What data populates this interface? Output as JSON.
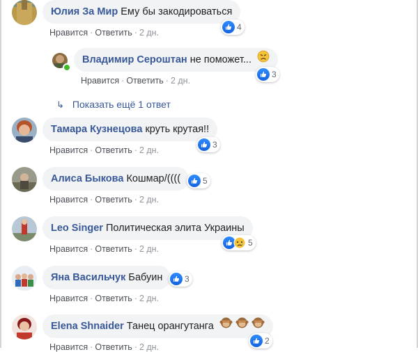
{
  "actions": {
    "like": "Нравится",
    "reply": "Ответить",
    "sep": "·"
  },
  "comments": [
    {
      "author": "Юлия За Мир",
      "text": "Ему бы закодироваться",
      "reactions": [
        "like"
      ],
      "count": "4",
      "time": "2 дн."
    },
    {
      "author": "Владимир Сероштан",
      "text": "не поможет...",
      "reactions": [
        "like"
      ],
      "count": "3",
      "time": "2 дн.",
      "emoji": "sad-face"
    },
    {
      "author": "Тамара Кузнецова",
      "text": "круть крутая!!",
      "reactions": [
        "like"
      ],
      "count": "3",
      "time": "2 дн."
    },
    {
      "author": "Алиса Быкова",
      "text": "Кошмар/((((",
      "reactions": [
        "like"
      ],
      "count": "5",
      "time": "2 дн."
    },
    {
      "author": "Leo Singer",
      "text": "Политическая элита Украины",
      "reactions": [
        "like",
        "sad"
      ],
      "count": "5",
      "time": "2 дн."
    },
    {
      "author": "Яна Васильчук",
      "text": "Бабуин",
      "reactions": [
        "like"
      ],
      "count": "3",
      "time": "2 дн."
    },
    {
      "author": "Elena Shnaider",
      "text": "Танец орангутанга",
      "reactions": [
        "like"
      ],
      "count": "2",
      "time": "2 дн.",
      "emoji": "see-no-evil-monkey x3"
    }
  ],
  "more_replies": {
    "arrow": "↳",
    "label": "Показать ещё 1 ответ"
  },
  "colors": {
    "author": "#385898",
    "bubble": "#f2f3f5",
    "meta": "#90949c",
    "like": "#1877f2"
  }
}
